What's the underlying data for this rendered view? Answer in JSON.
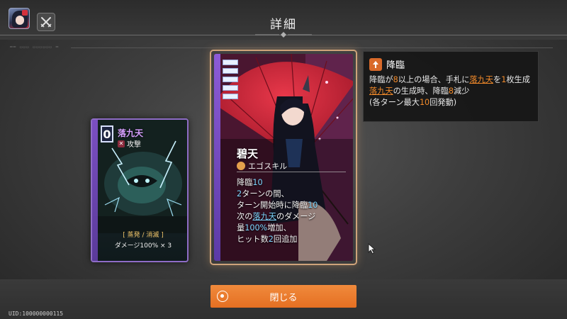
{
  "header": {
    "title": "詳細",
    "deco_text": "━━ ▭▭▭ ▭▭▭▭▭▭ ━"
  },
  "left_card": {
    "cost": "0",
    "name": "落九天",
    "type": "攻撃",
    "tag": "[ 蒸発 / 消滅 ]",
    "desc": "ダメージ100% × 3"
  },
  "center_card": {
    "name": "碧天",
    "type": "エゴスキル",
    "desc": {
      "l1_a": "降臨",
      "l1_b": "10",
      "l2_a": "2",
      "l2_b": "ターンの間、",
      "l3_a": "ターン開始時に降臨",
      "l3_b": "10",
      "l4_a": "次の",
      "l4_b": "落九天",
      "l4_c": "のダメージ",
      "l5_a": "量",
      "l5_b": "100%",
      "l5_c": "増加、",
      "l6_a": "ヒット数",
      "l6_b": "2",
      "l6_c": "回追加"
    }
  },
  "tooltip": {
    "title": "降臨",
    "p1_a": "降臨が",
    "p1_b": "8",
    "p1_c": "以上の場合、手札に",
    "p1_d": "落九天",
    "p1_e": "を",
    "p1_f": "1",
    "p1_g": "枚生成",
    "p2_a": "落九天",
    "p2_b": "の生成時、降臨",
    "p2_c": "8",
    "p2_d": "減少",
    "p3_a": "(各ターン最大",
    "p3_b": "10",
    "p3_c": "回発動)"
  },
  "footer": {
    "close_label": "閉じる",
    "uid": "UID:100000000115"
  },
  "colors": {
    "accent_orange": "#e8782a",
    "card_purple": "#8c5bd6",
    "highlight_blue": "#7dd6ff"
  },
  "icons": [
    "avatar-portrait",
    "crossed-swords-icon",
    "attack-icon",
    "ego-brain-icon",
    "descent-icon",
    "close-circle-icon",
    "mouse-cursor-icon"
  ]
}
